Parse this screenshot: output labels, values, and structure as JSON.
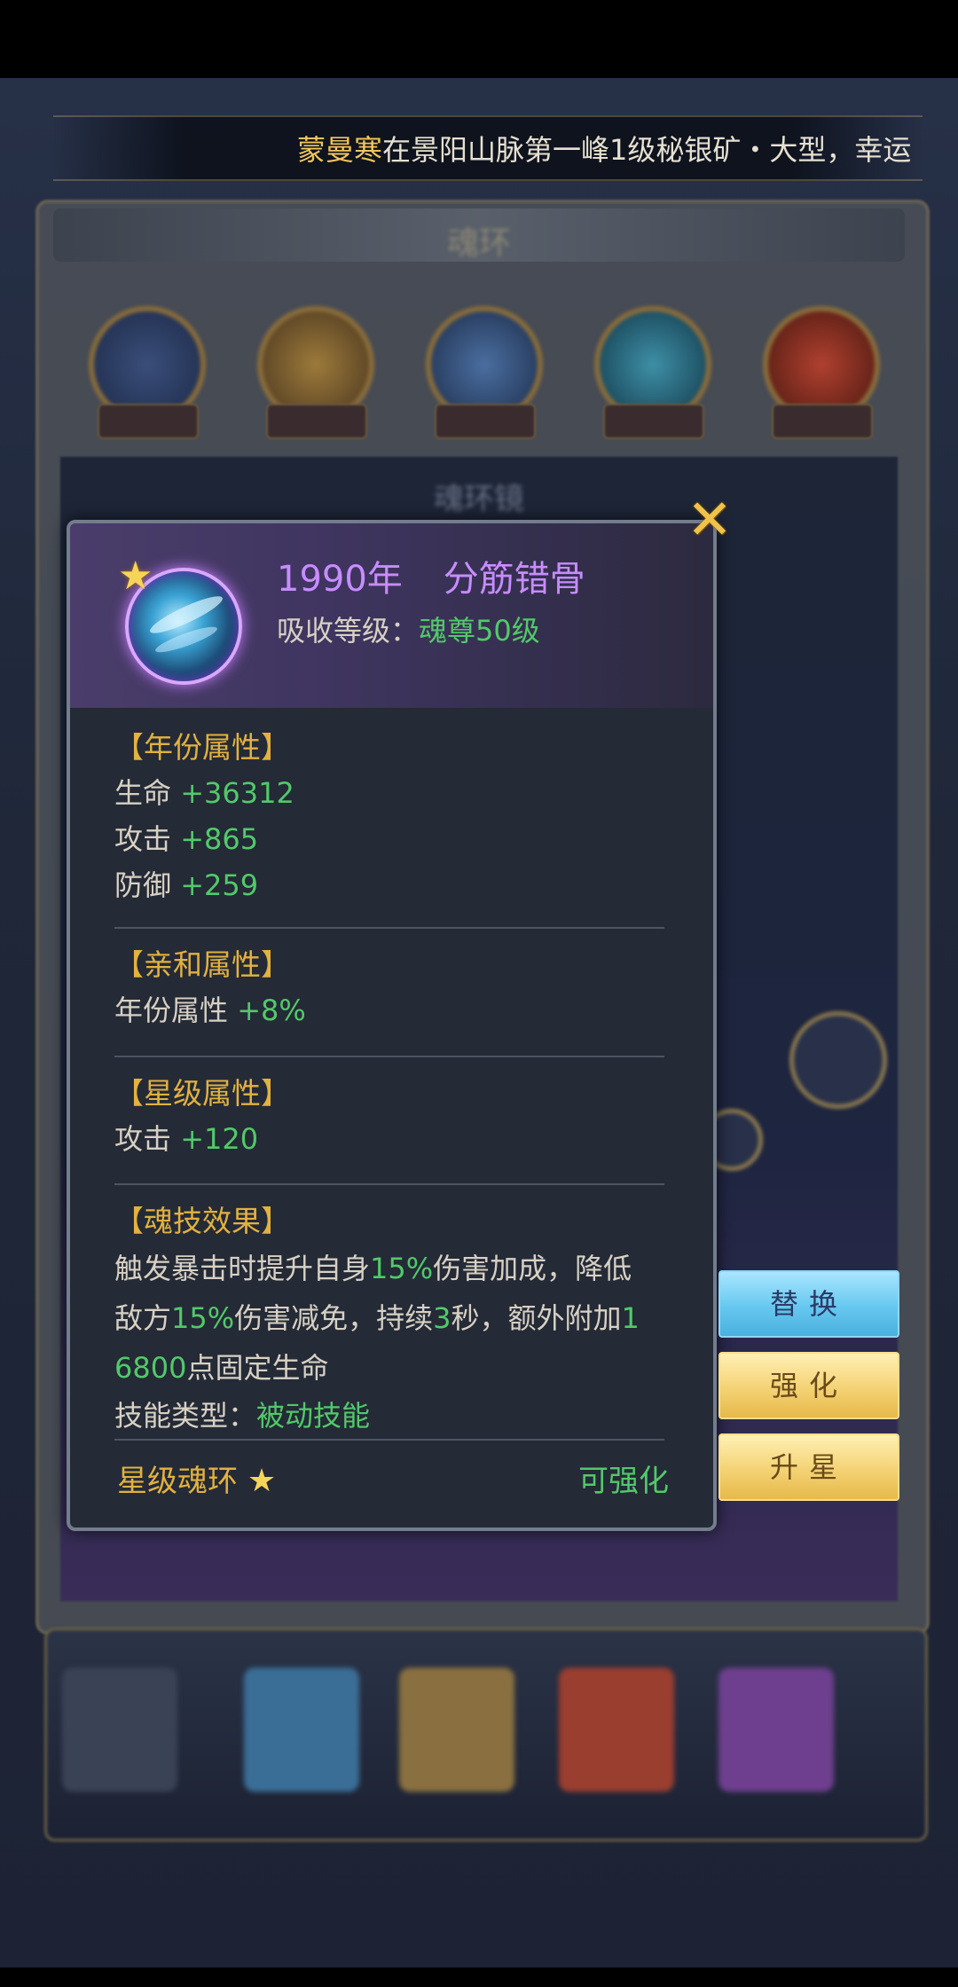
{
  "marquee": {
    "player": "蒙曼寒",
    "message": "在景阳山脉第一峰1级秘银矿・大型，幸运"
  },
  "background": {
    "title": "魂环",
    "inner_title": "魂环镜"
  },
  "popup": {
    "ring_year": "1990年",
    "ring_name": "分筋错骨",
    "absorb_label": "吸收等级：",
    "absorb_value": "魂尊50级",
    "sections": {
      "year_attr": {
        "title": "【年份属性】",
        "stats": [
          {
            "label": "生命",
            "value": "+36312"
          },
          {
            "label": "攻击",
            "value": "+865"
          },
          {
            "label": "防御",
            "value": "+259"
          }
        ]
      },
      "affinity_attr": {
        "title": "【亲和属性】",
        "stats": [
          {
            "label": "年份属性",
            "value": "+8%"
          }
        ]
      },
      "star_attr": {
        "title": "【星级属性】",
        "stats": [
          {
            "label": "攻击",
            "value": "+120"
          }
        ]
      },
      "skill_effect": {
        "title": "【魂技效果】",
        "desc_parts": [
          "触发暴击时提升自身",
          "15%",
          "伤害加成，降低",
          "敌方",
          "15%",
          "伤害减免，持续",
          "3",
          "秒，额外附加",
          "1",
          "6800",
          "点固定生命"
        ],
        "type_label": "技能类型：",
        "type_value": "被动技能"
      }
    },
    "footer_left": "星级魂环",
    "footer_star": "★",
    "footer_right": "可强化",
    "close_glyph": "✕"
  },
  "side_buttons": {
    "replace": "替换",
    "enhance": "强化",
    "star_up": "升星"
  },
  "colors": {
    "gold_title": "#e2b13f",
    "green_value": "#52c96a",
    "purple_name": "#c78cff"
  }
}
